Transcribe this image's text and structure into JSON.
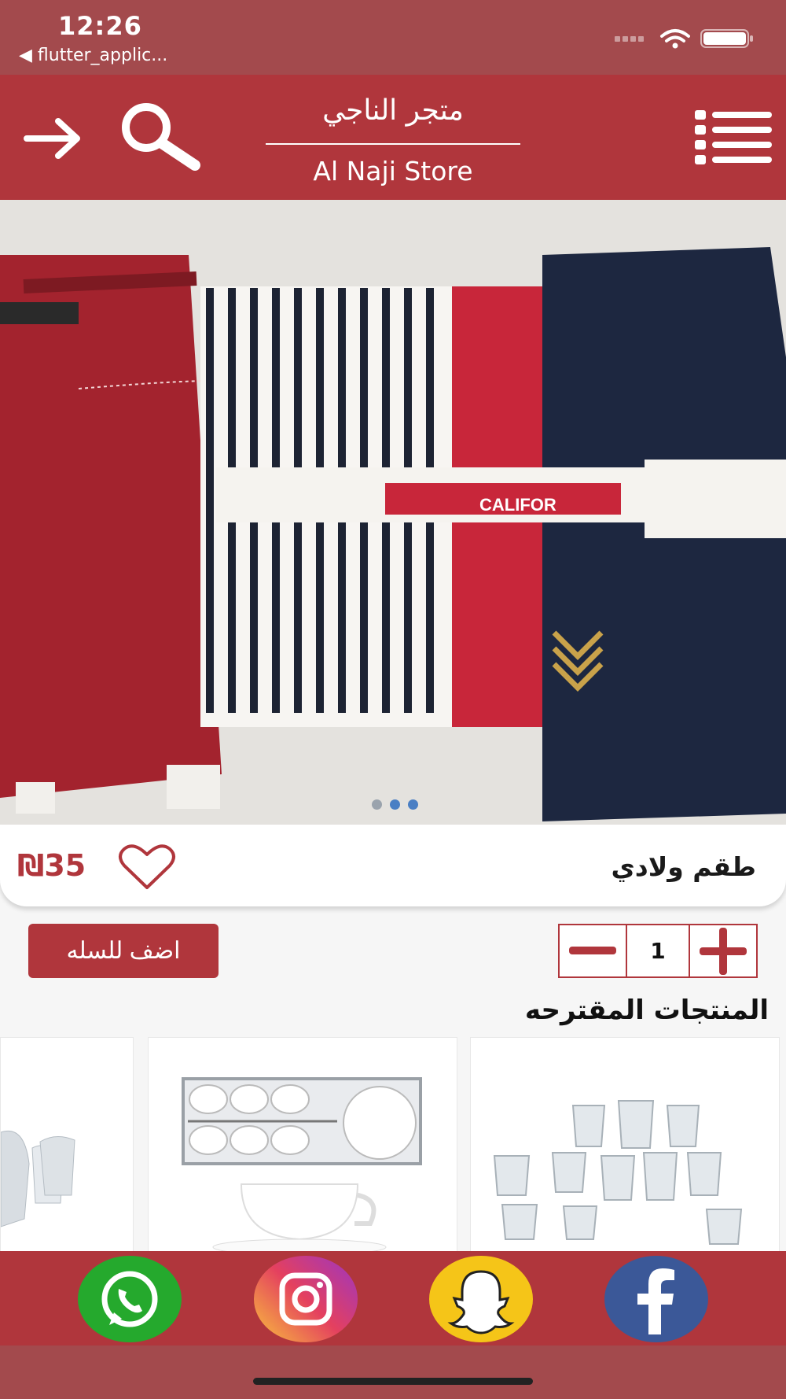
{
  "status_bar": {
    "time": "12:26",
    "back_label": "◀ flutter_applic..."
  },
  "header": {
    "title_ar": "متجر الناجي",
    "title_en": "Al Naji Store"
  },
  "product": {
    "name": "طقم ولادي",
    "price": "₪35",
    "slide_index": 2,
    "slide_count": 3
  },
  "cart": {
    "add_label": "اضف للسله",
    "quantity": "1"
  },
  "suggested": {
    "title": "المنتجات المقترحه"
  },
  "footer": {
    "icons": [
      "whatsapp-icon",
      "instagram-icon",
      "snapchat-icon",
      "facebook-icon"
    ]
  },
  "colors": {
    "brand": "#b0363c",
    "status_bar": "#a34a4d",
    "dot_active": "#4a7fc4",
    "dot_inactive": "#9aa3ad"
  }
}
